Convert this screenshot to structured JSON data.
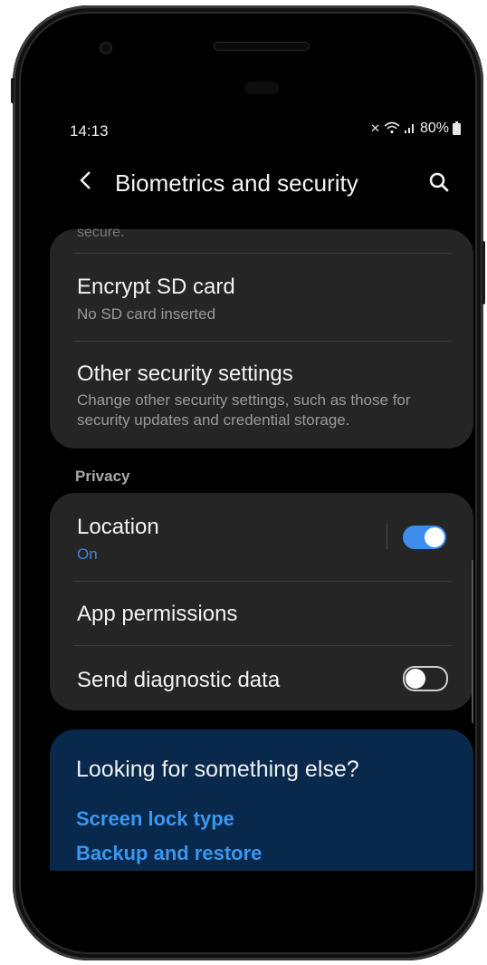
{
  "status_bar": {
    "time": "14:13",
    "icons": [
      "mute-icon",
      "wifi-icon",
      "signal-icon"
    ],
    "battery_text": "80%"
  },
  "appbar": {
    "back_glyph": "‹",
    "title": "Biometrics and security",
    "search_icon": "search-icon"
  },
  "security_card": {
    "faded_text": "secure.",
    "items": [
      {
        "title": "Encrypt SD card",
        "subtitle": "No SD card inserted"
      },
      {
        "title": "Other security settings",
        "subtitle": "Change other security settings, such as those for security updates and credential storage."
      }
    ]
  },
  "privacy": {
    "section_label": "Privacy",
    "location": {
      "title": "Location",
      "status": "On",
      "enabled": true
    },
    "app_permissions": {
      "title": "App permissions"
    },
    "diagnostic": {
      "title": "Send diagnostic data",
      "enabled": false
    }
  },
  "looking": {
    "heading": "Looking for something else?",
    "links": [
      "Screen lock type",
      "Backup and restore"
    ]
  },
  "colors": {
    "accent": "#3e8ded",
    "link": "#3a96f0",
    "card_bg": "#252525",
    "looking_bg": "#08294b"
  }
}
